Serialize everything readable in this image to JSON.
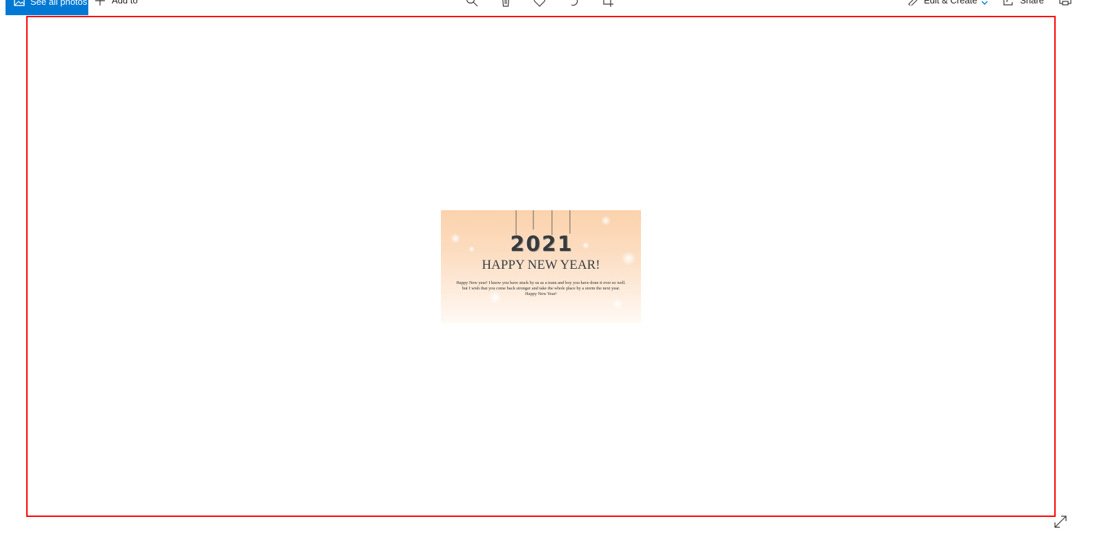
{
  "toolbar": {
    "see_all_label": "See all photos",
    "add_to_label": "Add to",
    "edit_create_label": "Edit & Create",
    "share_label": "Share",
    "more_label": "···",
    "accent_color": "#0078d4"
  },
  "icons": {
    "see_all": "photos-icon",
    "add_to": "plus-icon",
    "zoom": "zoom-icon",
    "delete": "trash-icon",
    "favorite": "heart-icon",
    "rotate": "rotate-icon",
    "crop": "crop-icon",
    "edit_create": "edit-create-icon",
    "share": "share-icon",
    "print": "print-icon",
    "expand": "expand-icon"
  },
  "viewer": {
    "frame_color": "#ff0000"
  },
  "photo": {
    "year": "2021",
    "headline": "HAPPY NEW YEAR!",
    "message": "Happy New year! I know you have stuck by us as a team and boy you have done it ever so well. but I wish that you come back stronger and take the whole place by a storm the next year. Happy New Year!"
  }
}
